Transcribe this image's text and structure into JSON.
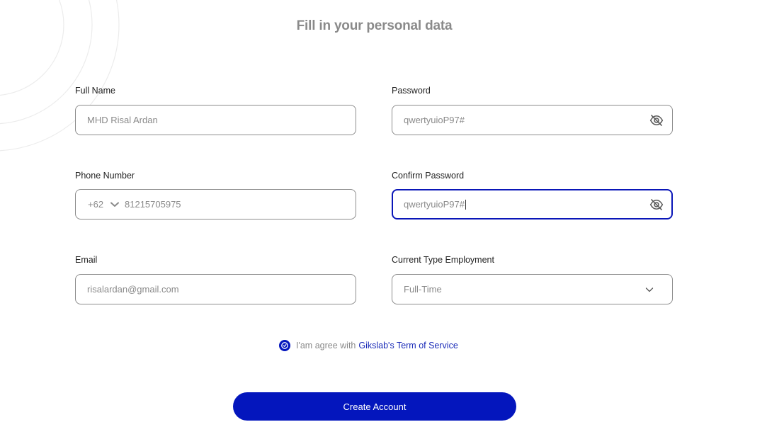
{
  "page": {
    "title": "Fill in your personal data"
  },
  "form": {
    "full_name": {
      "label": "Full Name",
      "value": "MHD Risal Ardan"
    },
    "password": {
      "label": "Password",
      "value": "qwertyuioP97#",
      "icon": "eye-off-icon"
    },
    "phone": {
      "label": "Phone Number",
      "country_code": "+62",
      "number": "81215705975"
    },
    "confirm_password": {
      "label": "Confirm Password",
      "value": "qwertyuioP97#",
      "icon": "eye-off-icon"
    },
    "email": {
      "label": "Email",
      "value": "risalardan@gmail.com"
    },
    "employment": {
      "label": "Current Type Employment",
      "selected": "Full-Time",
      "icon": "chevron-down-icon"
    }
  },
  "agreement": {
    "text": "I'am agree with",
    "link": "Gikslab's Term of Service",
    "checked": true
  },
  "actions": {
    "create_label": "Create Account"
  },
  "colors": {
    "accent": "#0416bd",
    "link": "#1a2bb8",
    "focus_border": "#0a16b8",
    "muted_text": "#8a8a8a"
  }
}
